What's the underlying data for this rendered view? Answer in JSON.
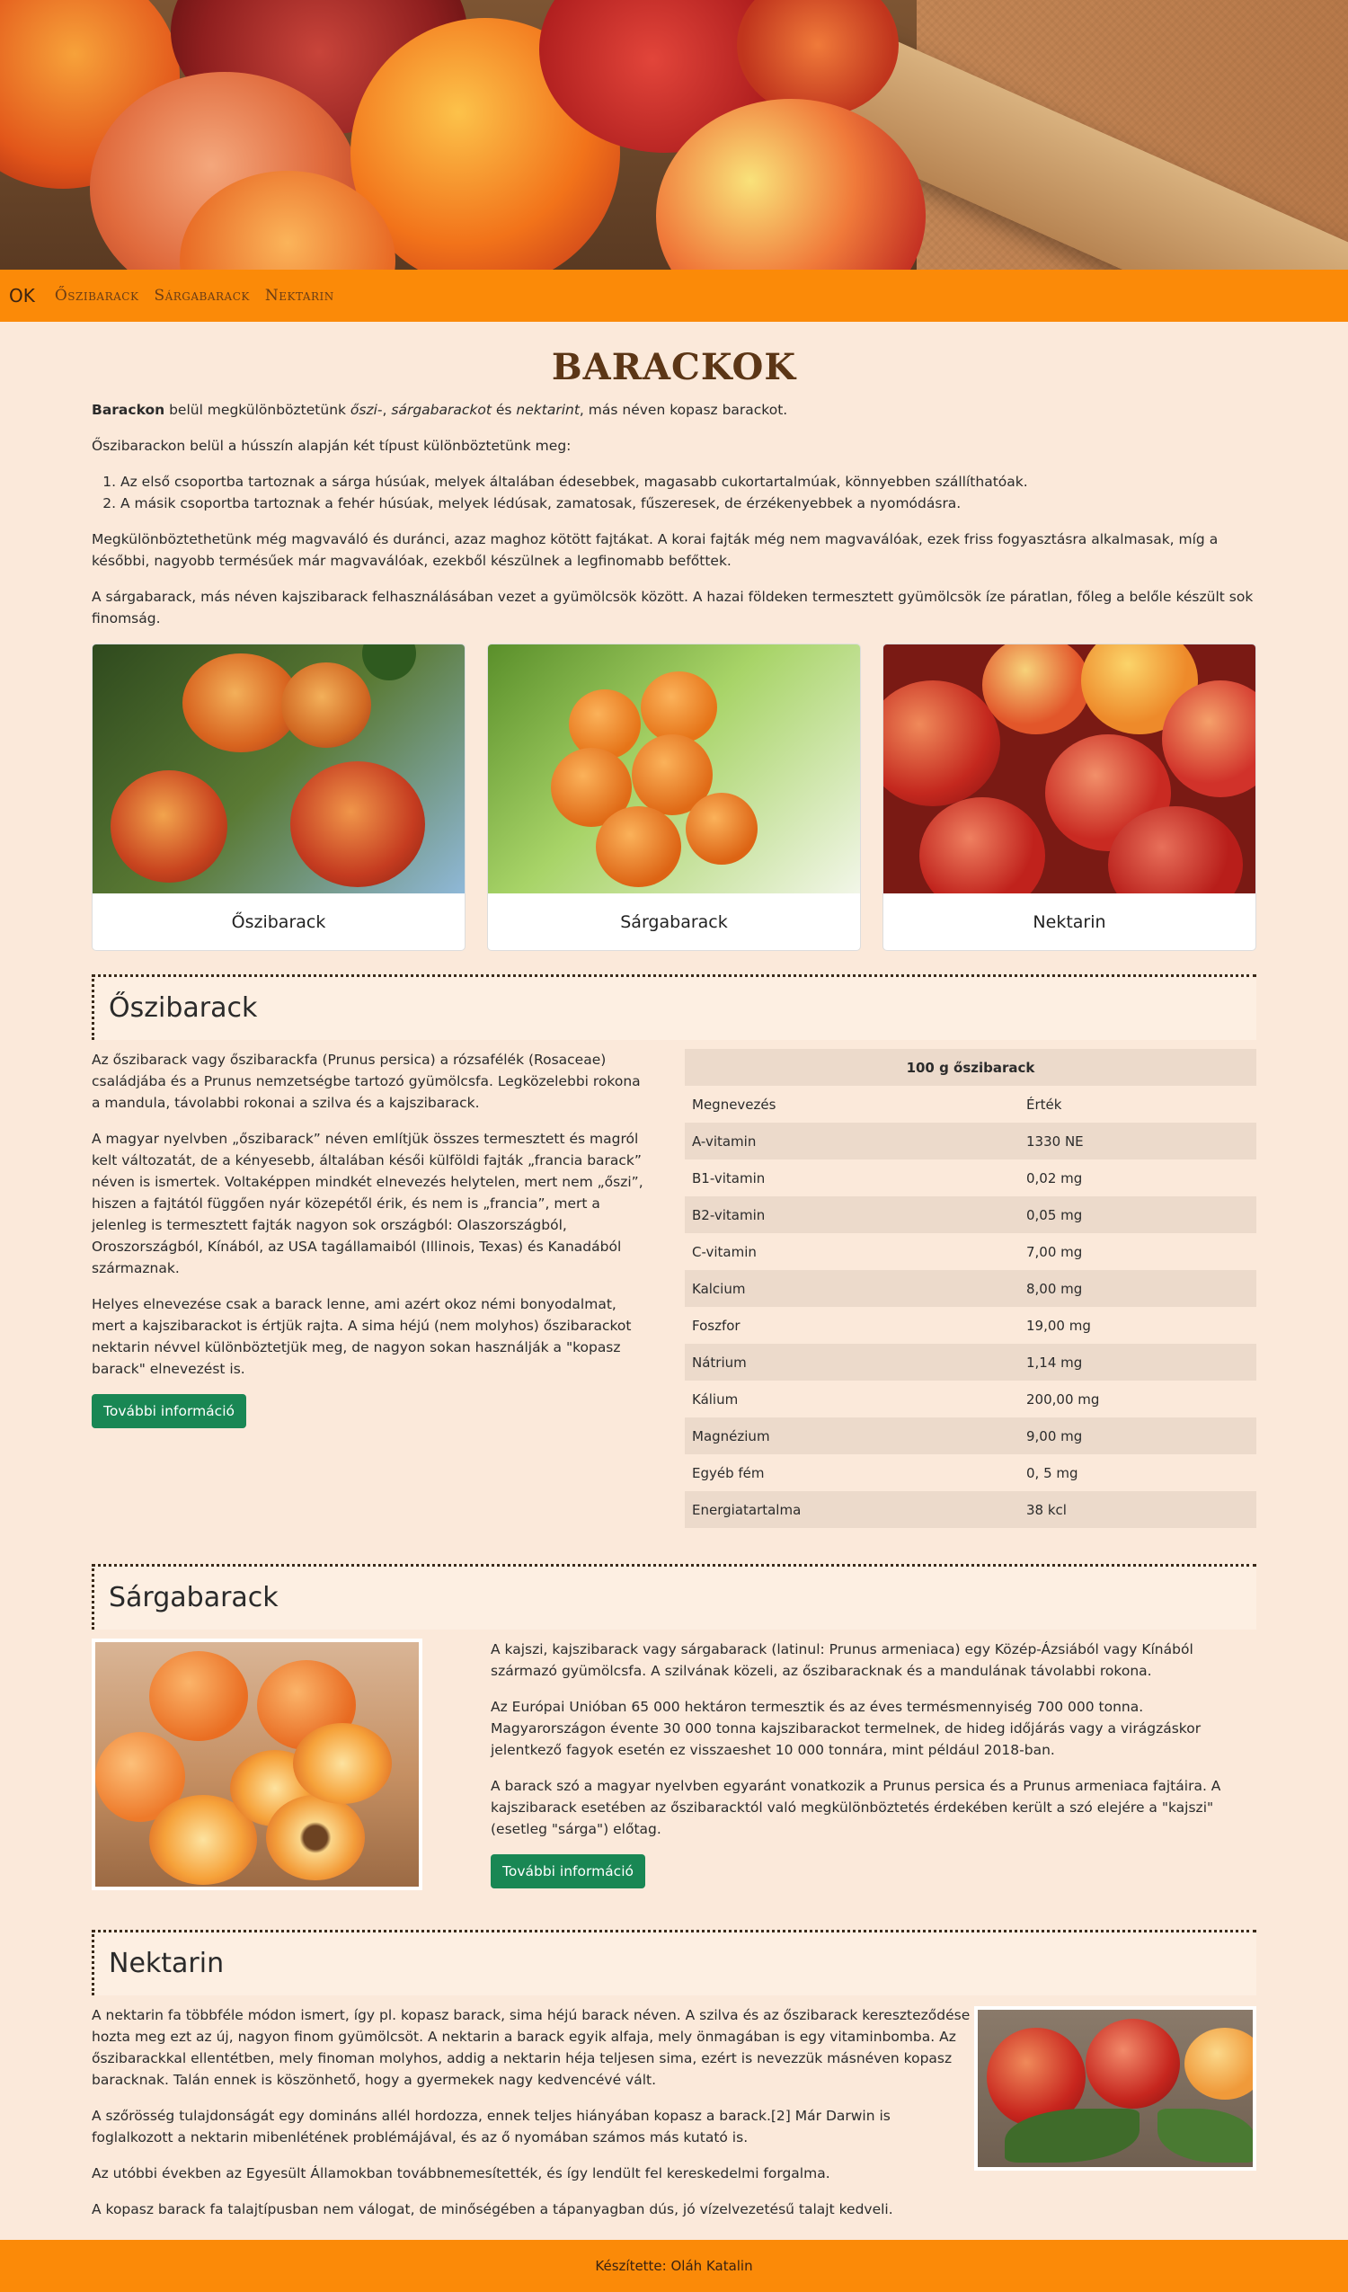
{
  "nav": {
    "brand": "OK",
    "links": [
      "Őszibarack",
      "Sárgabarack",
      "Nektarin"
    ]
  },
  "header": {
    "title": "BARACKOK"
  },
  "intro": {
    "p1_bold": "Barackon",
    "p1_a": " belül megkülönböztetünk ",
    "p1_i1": "őszi-",
    "p1_b": ", ",
    "p1_i2": "sárgabarackot",
    "p1_c": " és ",
    "p1_i3": "nektarint",
    "p1_d": ", más néven kopasz barackot.",
    "p2": "Őszibarackon belül a hússzín alapján két típust különböztetünk meg:",
    "list": [
      "Az első csoportba tartoznak a sárga húsúak, melyek általában édesebbek, magasabb cukortartalmúak, könnyebben szállíthatóak.",
      "A másik csoportba tartoznak a fehér húsúak, melyek lédúsak, zamatosak, fűszeresek, de érzékenyebbek a nyomódásra."
    ],
    "p3": "Megkülönböztethetünk még magvaváló és duránci, azaz maghoz kötött fajtákat. A korai fajták még nem magvaválóak, ezek friss fogyasztásra alkalmasak, míg a későbbi, nagyobb termésűek már magvaválóak, ezekből készülnek a legfinomabb befőttek.",
    "p4": "A sárgabarack, más néven kajszibarack felhasználásában vezet a gyümölcsök között. A hazai földeken termesztett gyümölcsök íze páratlan, főleg a belőle készült sok finomság."
  },
  "cards": [
    "Őszibarack",
    "Sárgabarack",
    "Nektarin"
  ],
  "oszi": {
    "heading": "Őszibarack",
    "paragraphs": [
      "Az őszibarack vagy őszibarackfa (Prunus persica) a rózsafélék (Rosaceae) családjába és a Prunus nemzetségbe tartozó gyümölcsfa. Legközelebbi rokona a mandula, távolabbi rokonai a szilva és a kajszibarack.",
      "A magyar nyelvben „őszibarack” néven említjük összes termesztett és magról kelt változatát, de a kényesebb, általában késői külföldi fajták „francia barack” néven is ismertek. Voltaképpen mindkét elnevezés helytelen, mert nem „őszi”, hiszen a fajtától függően nyár közepétől érik, és nem is „francia”, mert a jelenleg is termesztett fajták nagyon sok országból: Olaszországból, Oroszországból, Kínából, az USA tagállamaiból (Illinois, Texas) és Kanadából származnak.",
      "Helyes elnevezése csak a barack lenne, ami azért okoz némi bonyodalmat, mert a kajszibarackot is értjük rajta. A sima héjú (nem molyhos) őszibarackot nektarin névvel különböztetjük meg, de nagyon sokan használják a \"kopasz barack\" elnevezést is."
    ],
    "button": "További információ",
    "table": {
      "caption": "100 g őszibarack",
      "head": [
        "Megnevezés",
        "Érték"
      ],
      "rows": [
        [
          "A-vitamin",
          "1330 NE"
        ],
        [
          "B1-vitamin",
          "0,02 mg"
        ],
        [
          "B2-vitamin",
          "0,05 mg"
        ],
        [
          "C-vitamin",
          "7,00 mg"
        ],
        [
          "Kalcium",
          "8,00 mg"
        ],
        [
          "Foszfor",
          "19,00 mg"
        ],
        [
          "Nátrium",
          "1,14 mg"
        ],
        [
          "Kálium",
          "200,00 mg"
        ],
        [
          "Magnézium",
          "9,00 mg"
        ],
        [
          "Egyéb fém",
          "0, 5 mg"
        ],
        [
          "Energiatartalma",
          "38 kcl"
        ]
      ]
    }
  },
  "sarga": {
    "heading": "Sárgabarack",
    "paragraphs": [
      "A kajszi, kajszibarack vagy sárgabarack (latinul: Prunus armeniaca) egy Közép-Ázsiából vagy Kínából származó gyümölcsfa. A szilvának közeli, az őszibaracknak és a mandulának távolabbi rokona.",
      "Az Európai Unióban 65 000 hektáron termesztik és az éves termésmennyiség 700 000 tonna. Magyarországon évente 30 000 tonna kajszibarackot termelnek, de hideg időjárás vagy a virágzáskor jelentkező fagyok esetén ez visszaeshet 10 000 tonnára, mint például 2018-ban.",
      "A barack szó a magyar nyelvben egyaránt vonatkozik a Prunus persica és a Prunus armeniaca fajtáira. A kajszibarack esetében az őszibaracktól való megkülönböztetés érdekében került a szó elejére a \"kajszi\" (esetleg \"sárga\") előtag."
    ],
    "button": "További információ"
  },
  "nektarin": {
    "heading": "Nektarin",
    "paragraphs": [
      "A nektarin fa többféle módon ismert, így pl. kopasz barack, sima héjú barack néven. A szilva és az őszibarack kereszteződése hozta meg ezt az új, nagyon finom gyümölcsöt. A nektarin a barack egyik alfaja, mely önmagában is egy vitaminbomba. Az őszibarackkal ellentétben, mely finoman molyhos, addig a nektarin héja teljesen sima, ezért is nevezzük másnéven kopasz baracknak. Talán ennek is köszönhető, hogy a gyermekek nagy kedvencévé vált.",
      "A szőrösség tulajdonságát egy domináns allél hordozza, ennek teljes hiányában kopasz a barack.[2] Már Darwin is foglalkozott a nektarin mibenlétének problémájával, és az ő nyomában számos más kutató is.",
      "Az utóbbi években az Egyesült Államokban továbbnemesítették, és így lendült fel kereskedelmi forgalma.",
      "A kopasz barack fa talajtípusban nem válogat, de minőségében a tápanyagban dús, jó vízelvezetésű talajt kedveli."
    ]
  },
  "footer": {
    "text": "Készítette: Oláh Katalin"
  },
  "colors": {
    "accent": "#fb8a08",
    "background": "#fbe9da",
    "button": "#198754",
    "title": "#5c3616"
  }
}
